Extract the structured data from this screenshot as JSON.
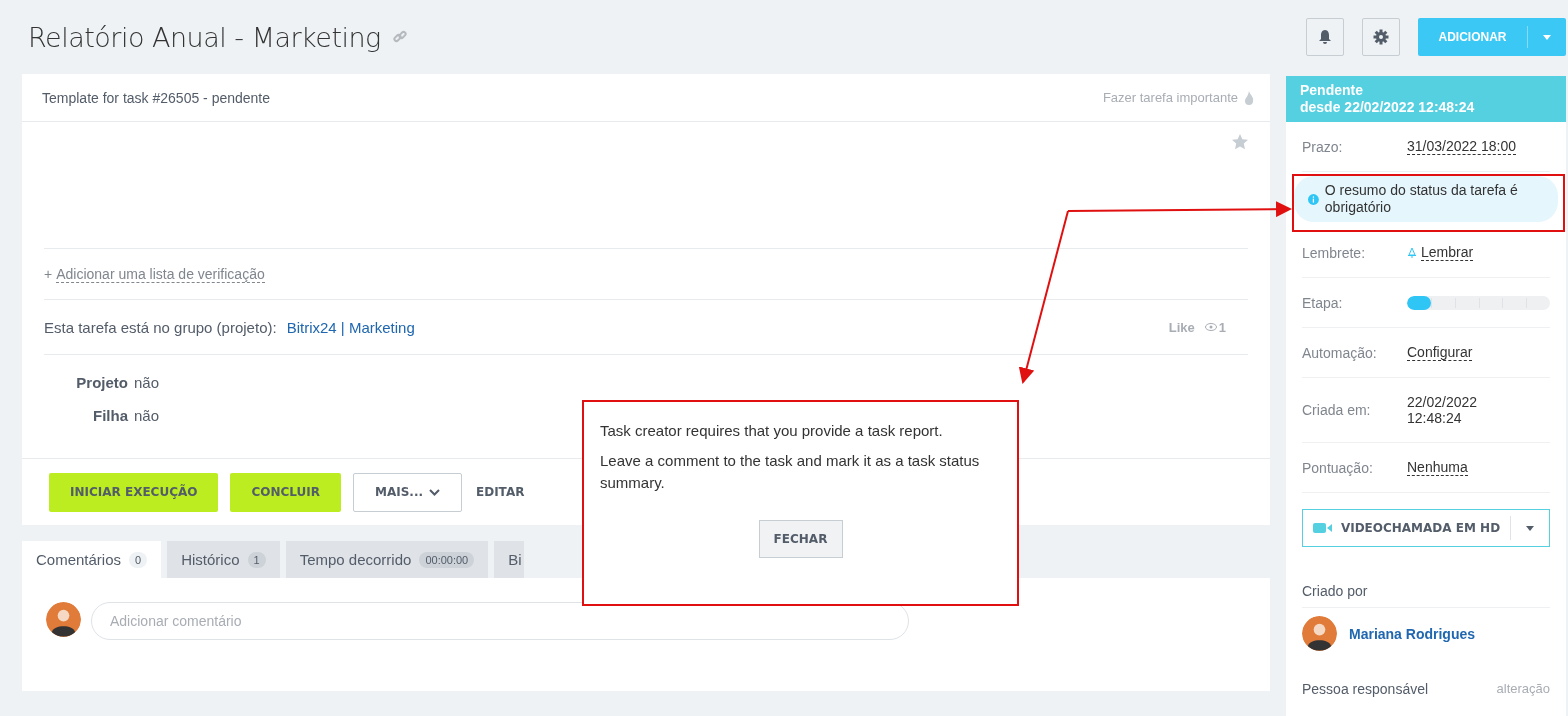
{
  "header": {
    "title": "Relatório Anual - Marketing",
    "add_button": "ADICIONAR"
  },
  "task": {
    "subtitle": "Template for task #26505 - pendente",
    "important_link": "Fazer tarefa importante",
    "favorite": false,
    "checklist_plus": "+",
    "checklist_link": "Adicionar uma lista de verificação",
    "group_label": "Esta tarefa está no grupo (projeto):",
    "group_link": "Bitrix24 | Marketing",
    "like": "Like",
    "views": "1",
    "fields": [
      {
        "label": "Projeto",
        "value": "não"
      },
      {
        "label": "Filha",
        "value": "não"
      }
    ],
    "actions": [
      {
        "label": "INICIAR EXECUÇÃO",
        "kind": "primary"
      },
      {
        "label": "CONCLUIR",
        "kind": "primary"
      },
      {
        "label": "MAIS...",
        "kind": "dropdown"
      },
      {
        "label": "EDITAR",
        "kind": "link"
      }
    ]
  },
  "tabs": [
    {
      "label": "Comentários",
      "count": "0",
      "selected": true
    },
    {
      "label": "Histórico",
      "count": "1",
      "selected": false
    },
    {
      "label": "Tempo decorrido",
      "count": "00:00:00",
      "selected": false
    },
    {
      "label": "Bi",
      "selected": false
    }
  ],
  "comment": {
    "placeholder": "Adicionar comentário"
  },
  "sidebar": {
    "status": "Pendente",
    "status_since": "desde 22/02/2022 12:48:24",
    "rows": [
      {
        "kind": "field",
        "label": "Prazo:",
        "value": "31/03/2022 18:00"
      },
      {
        "kind": "notice",
        "text": "O resumo do status da tarefa é obrigatório"
      },
      {
        "kind": "reminder",
        "label": "Lembrete:",
        "value": "Lembrar"
      },
      {
        "kind": "stage",
        "label": "Etapa:",
        "level": 0.17
      },
      {
        "kind": "field",
        "label": "Automação:",
        "value": "Configurar"
      },
      {
        "kind": "plain",
        "label": "Criada em:",
        "value": "22/02/2022 12:48:24"
      },
      {
        "kind": "field",
        "label": "Pontuação:",
        "value": "Nenhuma"
      }
    ],
    "video_button": "VIDEOCHAMADA EM HD",
    "created_by_label": "Criado por",
    "creator": "Mariana Rodrigues",
    "responsible_label": "Pessoa responsável",
    "responsible_change": "alteração"
  },
  "dialog": {
    "lines": [
      "Task creator requires that you provide a task report.",
      "Leave a comment to the task and mark it as a task status summary."
    ],
    "close_button": "FECHAR"
  }
}
